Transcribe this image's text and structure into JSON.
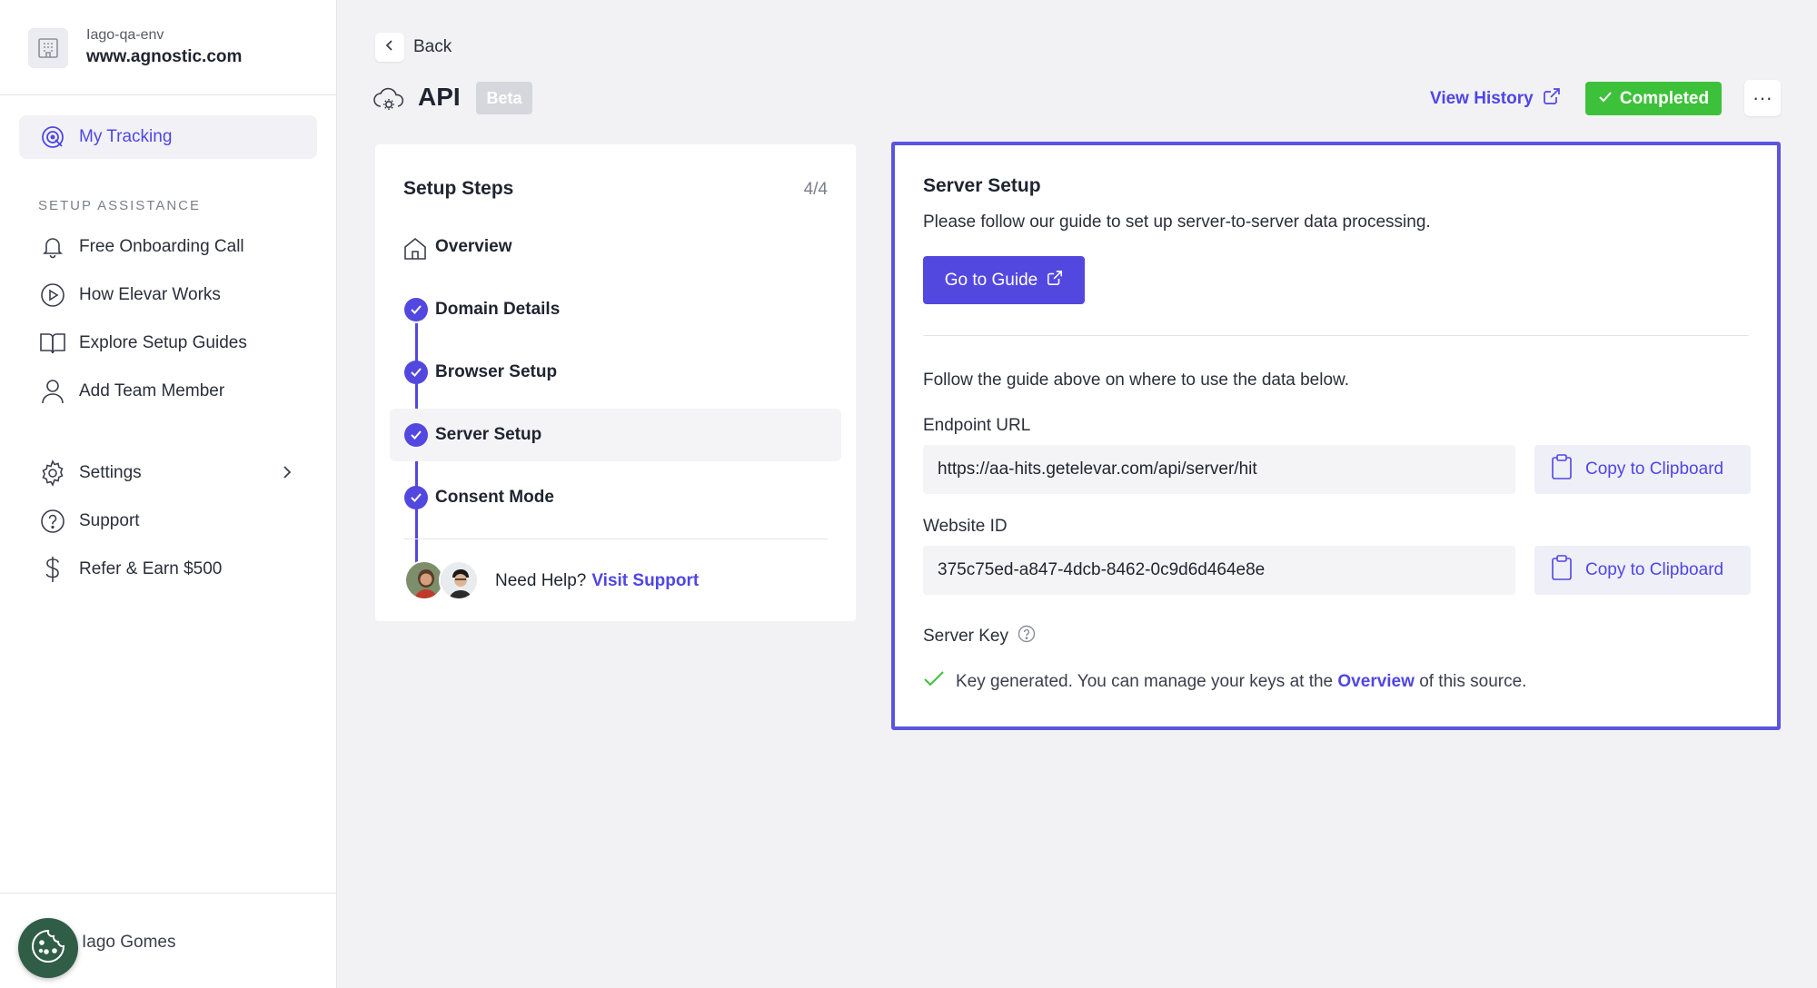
{
  "sidebar": {
    "org_env": "Iago-qa-env",
    "org_domain": "www.agnostic.com",
    "active_item": "My Tracking",
    "section_label": "SETUP ASSISTANCE",
    "setup_items": [
      {
        "label": "Free Onboarding Call",
        "icon": "bell-icon"
      },
      {
        "label": "How Elevar Works",
        "icon": "play-icon"
      },
      {
        "label": "Explore Setup Guides",
        "icon": "book-icon"
      },
      {
        "label": "Add Team Member",
        "icon": "user-icon"
      }
    ],
    "bottom_items": [
      {
        "label": "Settings",
        "icon": "gear-icon"
      },
      {
        "label": "Support",
        "icon": "question-icon"
      },
      {
        "label": "Refer & Earn $500",
        "icon": "dollar-icon"
      }
    ],
    "user_name": "Iago Gomes"
  },
  "header": {
    "back_label": "Back",
    "title": "API",
    "badge": "Beta",
    "view_history": "View History",
    "status": "Completed",
    "more": "···"
  },
  "steps": {
    "title": "Setup Steps",
    "count": "4/4",
    "items": [
      {
        "label": "Overview",
        "state": "home"
      },
      {
        "label": "Domain Details",
        "state": "done"
      },
      {
        "label": "Browser Setup",
        "state": "done"
      },
      {
        "label": "Server Setup",
        "state": "done",
        "active": true
      },
      {
        "label": "Consent Mode",
        "state": "done"
      }
    ],
    "help_text": "Need Help?",
    "help_link": "Visit Support"
  },
  "server": {
    "title": "Server Setup",
    "description": "Please follow our guide to set up server-to-server data processing.",
    "guide_button": "Go to Guide",
    "follow_text": "Follow the guide above on where to use the data below.",
    "endpoint_label": "Endpoint URL",
    "endpoint_value": "https://aa-hits.getelevar.com/api/server/hit",
    "website_id_label": "Website ID",
    "website_id_value": "375c75ed-a847-4dcb-8462-0c9d6d464e8e",
    "copy_label": "Copy to Clipboard",
    "server_key_label": "Server Key",
    "key_status_prefix": "Key generated. You can manage your keys at the",
    "key_status_link": "Overview",
    "key_status_suffix": "of this source."
  },
  "colors": {
    "accent": "#4f46e5",
    "completed": "#3ec13a",
    "card_border": "#5b54e0"
  }
}
